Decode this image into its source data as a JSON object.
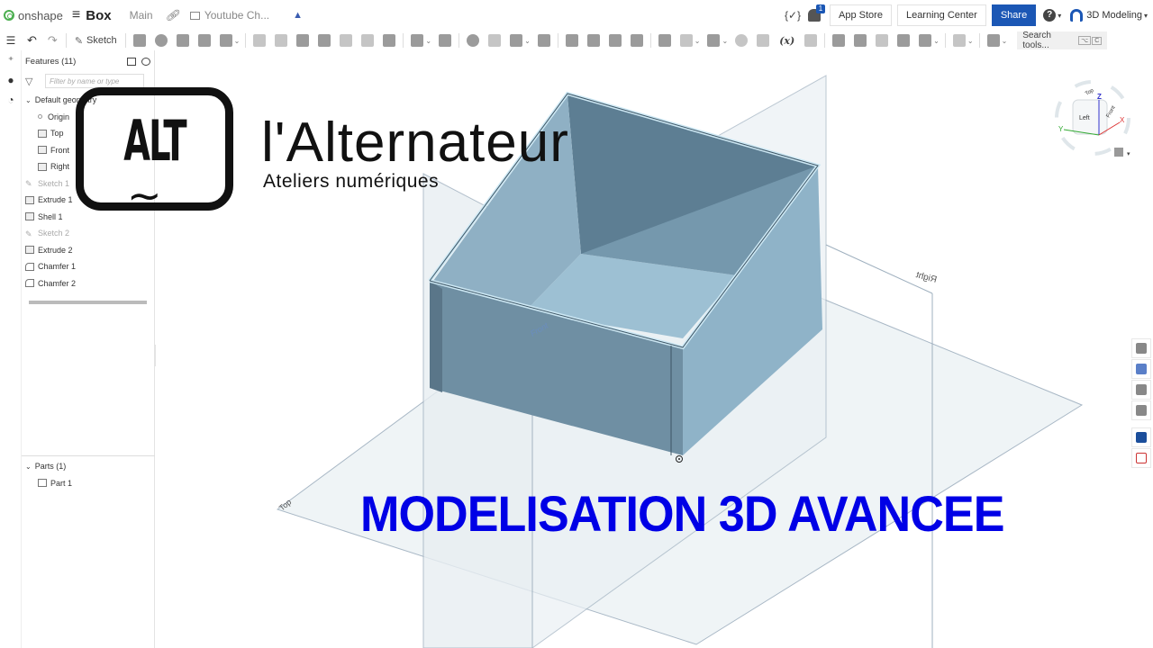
{
  "topbar": {
    "brand": "onshape",
    "document_title": "Box",
    "workspace": "Main",
    "folder": "Youtube Ch...",
    "notification_count": "1",
    "app_store": "App Store",
    "learning_center": "Learning Center",
    "share": "Share",
    "user": "3D Modeling"
  },
  "toolbar": {
    "sketch": "Sketch",
    "fx": "(x)",
    "search_placeholder": "Search tools...",
    "search_kbd1": "⌥",
    "search_kbd2": "C"
  },
  "feature_panel": {
    "title": "Features (11)",
    "filter_placeholder": "Filter by name or type",
    "default_geometry": "Default geometry",
    "geometry_items": [
      "Origin",
      "Top",
      "Front",
      "Right"
    ],
    "features": [
      {
        "label": "Sketch 1",
        "icon": "sketch-icon",
        "suppressed": true
      },
      {
        "label": "Extrude 1",
        "icon": "extrude-icon",
        "suppressed": false
      },
      {
        "label": "Shell 1",
        "icon": "shell-icon",
        "suppressed": false
      },
      {
        "label": "Sketch 2",
        "icon": "sketch-icon",
        "suppressed": true
      },
      {
        "label": "Extrude 2",
        "icon": "extrude-icon",
        "suppressed": false
      },
      {
        "label": "Chamfer 1",
        "icon": "chamfer-icon",
        "suppressed": false
      },
      {
        "label": "Chamfer 2",
        "icon": "chamfer-icon",
        "suppressed": false
      }
    ],
    "parts_title": "Parts (1)",
    "parts": [
      "Part 1"
    ]
  },
  "viewport": {
    "plane_labels": {
      "top": "Top",
      "front": "Front",
      "right": "Right"
    },
    "view_cube": {
      "top": "Top",
      "left": "Left",
      "front": "Front",
      "axes": [
        "X",
        "Y",
        "Z"
      ]
    },
    "colors": {
      "part_face": "#8fb3c8",
      "plane": "#e8eef3",
      "axis_x": "#d33",
      "axis_y": "#3a3",
      "axis_z": "#33c"
    }
  },
  "overlay": {
    "logo_mark": "ALT",
    "logo_tilde": "~",
    "brand_name": "l'Alternateur",
    "brand_tagline": "Ateliers numériques",
    "caption": "MODELISATION 3D AVANCEE",
    "caption_color": "#0000e6"
  }
}
